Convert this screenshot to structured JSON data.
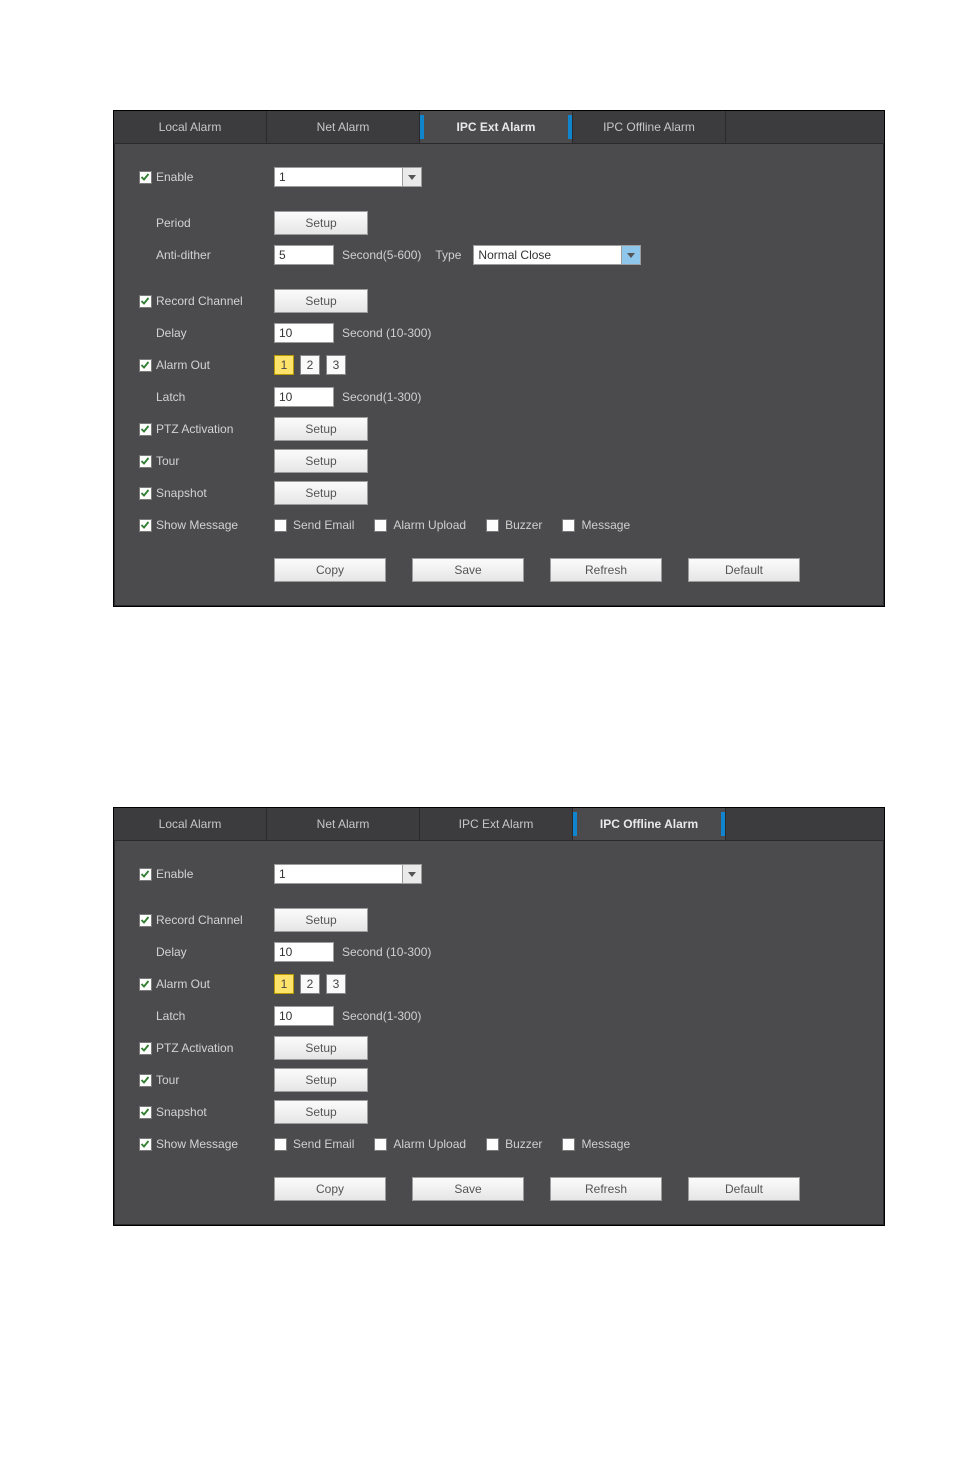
{
  "panels": [
    {
      "active_tab": 2,
      "tabs": [
        "Local Alarm",
        "Net Alarm",
        "IPC Ext Alarm",
        "IPC Offline Alarm"
      ],
      "enable": {
        "checked": true,
        "label": "Enable",
        "channel_value": "1"
      },
      "period": {
        "label": "Period",
        "button": "Setup"
      },
      "anti_dither": {
        "label": "Anti-dither",
        "value": "5",
        "unit": "Second(5-600)"
      },
      "type": {
        "label": "Type",
        "value": "Normal Close"
      },
      "record_channel": {
        "checked": true,
        "label": "Record Channel",
        "button": "Setup"
      },
      "delay": {
        "label": "Delay",
        "value": "10",
        "unit": "Second (10-300)"
      },
      "alarm_out": {
        "checked": true,
        "label": "Alarm Out",
        "selected_index": 0,
        "chips": [
          "1",
          "2",
          "3"
        ]
      },
      "latch": {
        "label": "Latch",
        "value": "10",
        "unit": "Second(1-300)"
      },
      "ptz": {
        "checked": true,
        "label": "PTZ Activation",
        "button": "Setup"
      },
      "tour": {
        "checked": true,
        "label": "Tour",
        "button": "Setup"
      },
      "snapshot": {
        "checked": true,
        "label": "Snapshot",
        "button": "Setup"
      },
      "show_message": {
        "checked": true,
        "label": "Show Message"
      },
      "notify": {
        "send_email": {
          "checked": false,
          "label": "Send Email"
        },
        "alarm_upload": {
          "checked": false,
          "label": "Alarm Upload"
        },
        "buzzer": {
          "checked": false,
          "label": "Buzzer"
        },
        "message": {
          "checked": false,
          "label": "Message"
        }
      },
      "buttons": {
        "copy": "Copy",
        "save": "Save",
        "refresh": "Refresh",
        "default": "Default"
      },
      "has_period_section": true
    },
    {
      "active_tab": 3,
      "tabs": [
        "Local Alarm",
        "Net Alarm",
        "IPC Ext Alarm",
        "IPC Offline Alarm"
      ],
      "enable": {
        "checked": true,
        "label": "Enable",
        "channel_value": "1"
      },
      "record_channel": {
        "checked": true,
        "label": "Record Channel",
        "button": "Setup"
      },
      "delay": {
        "label": "Delay",
        "value": "10",
        "unit": "Second (10-300)"
      },
      "alarm_out": {
        "checked": true,
        "label": "Alarm Out",
        "selected_index": 0,
        "chips": [
          "1",
          "2",
          "3"
        ]
      },
      "latch": {
        "label": "Latch",
        "value": "10",
        "unit": "Second(1-300)"
      },
      "ptz": {
        "checked": true,
        "label": "PTZ Activation",
        "button": "Setup"
      },
      "tour": {
        "checked": true,
        "label": "Tour",
        "button": "Setup"
      },
      "snapshot": {
        "checked": true,
        "label": "Snapshot",
        "button": "Setup"
      },
      "show_message": {
        "checked": true,
        "label": "Show Message"
      },
      "notify": {
        "send_email": {
          "checked": false,
          "label": "Send Email"
        },
        "alarm_upload": {
          "checked": false,
          "label": "Alarm Upload"
        },
        "buzzer": {
          "checked": false,
          "label": "Buzzer"
        },
        "message": {
          "checked": false,
          "label": "Message"
        }
      },
      "buttons": {
        "copy": "Copy",
        "save": "Save",
        "refresh": "Refresh",
        "default": "Default"
      },
      "has_period_section": false
    }
  ]
}
